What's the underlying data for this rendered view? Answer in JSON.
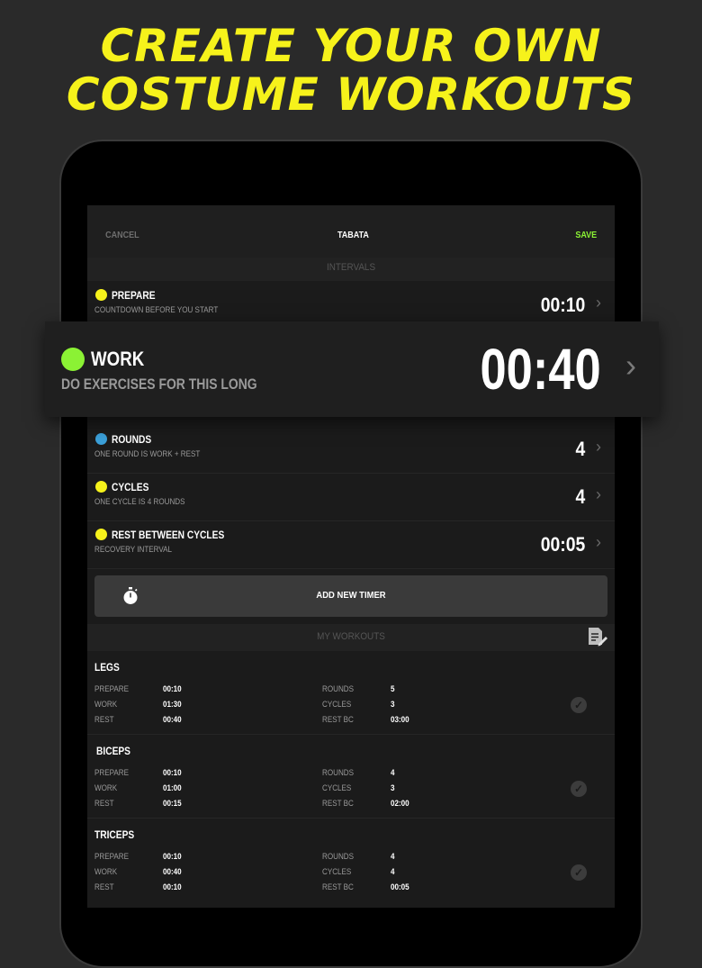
{
  "headline": {
    "line1": "CREATE YOUR OWN",
    "line2": "COSTUME WORKOUTS"
  },
  "topbar": {
    "cancel": "CANCEL",
    "title": "TABATA",
    "save": "SAVE"
  },
  "colors": {
    "accent_yellow": "#f6f21b",
    "green": "#8bf234",
    "blue": "#3b9fd8"
  },
  "intervals": {
    "section_label": "INTERVALS",
    "prepare": {
      "title": "PREPARE",
      "subtitle": "COUNTDOWN BEFORE YOU START",
      "value": "00:10",
      "dot": "yellow"
    },
    "work": {
      "title": "WORK",
      "subtitle": "DO EXERCISES FOR THIS LONG",
      "value": "00:40",
      "dot": "green"
    },
    "rounds": {
      "title": "ROUNDS",
      "subtitle": "ONE ROUND IS WORK + REST",
      "value": "4",
      "dot": "blue"
    },
    "cycles": {
      "title": "CYCLES",
      "subtitle": "ONE CYCLE IS  4 ROUNDS",
      "value": "4",
      "dot": "yellow"
    },
    "rest_between": {
      "title": "REST BETWEEN CYCLES",
      "subtitle": "RECOVERY INTERVAL",
      "value": "00:05",
      "dot": "yellow"
    }
  },
  "add_timer": {
    "label": "ADD NEW TIMER",
    "icon": "stopwatch-icon"
  },
  "my_workouts": {
    "section_label": "MY WORKOUTS",
    "edit_icon": "edit-note-icon",
    "items": [
      {
        "name": "LEGS",
        "left": [
          {
            "k": "PREPARE",
            "v": "00:10"
          },
          {
            "k": "WORK",
            "v": "01:30"
          },
          {
            "k": "REST",
            "v": "00:40"
          }
        ],
        "right": [
          {
            "k": "ROUNDS",
            "v": "5"
          },
          {
            "k": "CYCLES",
            "v": "3"
          },
          {
            "k": "REST BC",
            "v": "03:00"
          }
        ]
      },
      {
        "name": "BICEPS",
        "left": [
          {
            "k": "PREPARE",
            "v": "00:10"
          },
          {
            "k": "WORK",
            "v": "01:00"
          },
          {
            "k": "REST",
            "v": "00:15"
          }
        ],
        "right": [
          {
            "k": "ROUNDS",
            "v": "4"
          },
          {
            "k": "CYCLES",
            "v": "3"
          },
          {
            "k": "REST BC",
            "v": "02:00"
          }
        ]
      },
      {
        "name": "TRICEPS",
        "left": [
          {
            "k": "PREPARE",
            "v": "00:10"
          },
          {
            "k": "WORK",
            "v": "00:40"
          },
          {
            "k": "REST",
            "v": "00:10"
          }
        ],
        "right": [
          {
            "k": "ROUNDS",
            "v": "4"
          },
          {
            "k": "CYCLES",
            "v": "4"
          },
          {
            "k": "REST BC",
            "v": "00:05"
          }
        ]
      }
    ]
  }
}
